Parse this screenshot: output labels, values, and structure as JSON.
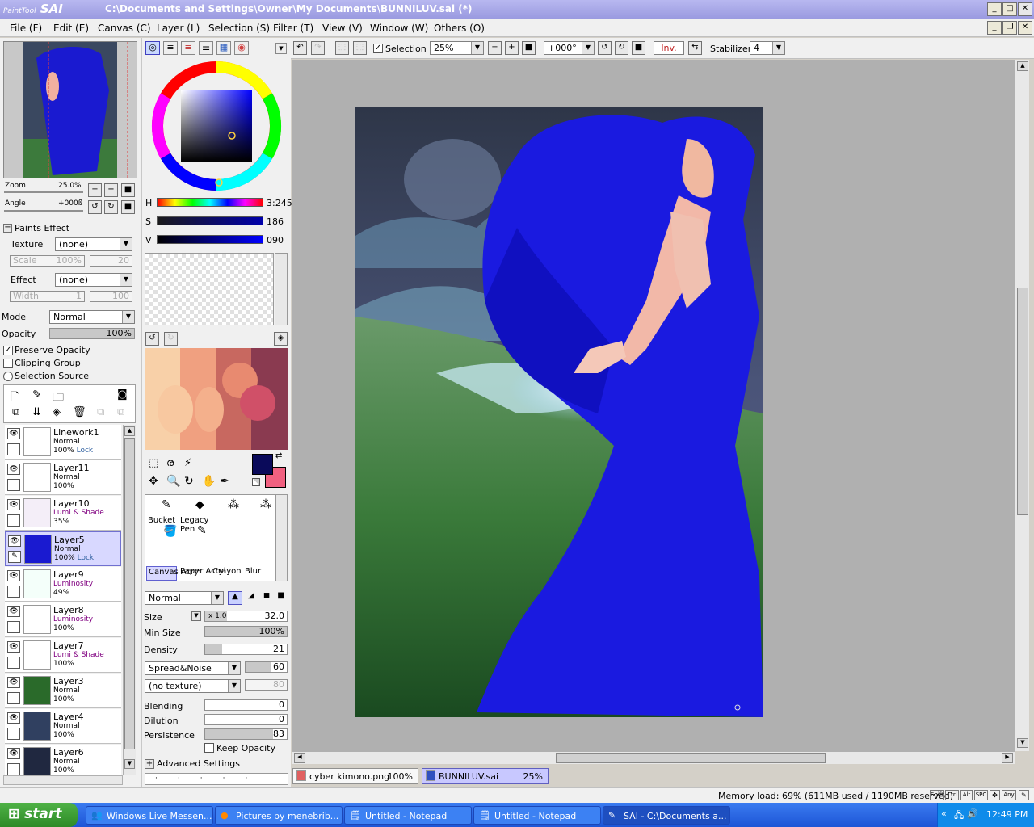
{
  "window": {
    "logo_small": "PaintTool",
    "logo_big": "SAI",
    "title": "C:\\Documents and Settings\\Owner\\My Documents\\BUNNILUV.sai (*)"
  },
  "menu": [
    "File (F)",
    "Edit (E)",
    "Canvas (C)",
    "Layer (L)",
    "Selection (S)",
    "Filter (T)",
    "View (V)",
    "Window (W)",
    "Others (O)"
  ],
  "navigator": {
    "zoom_label": "Zoom",
    "zoom_value": "25.0%",
    "angle_label": "Angle",
    "angle_value": "+000ß"
  },
  "paints_effect": {
    "title": "Paints Effect",
    "texture_label": "Texture",
    "texture_value": "(none)",
    "scale_label": "Scale",
    "scale_value": "100%",
    "scale_num": "20",
    "effect_label": "Effect",
    "effect_value": "(none)",
    "width_label": "Width",
    "width_value": "1",
    "width_num": "100"
  },
  "layer_props": {
    "mode_label": "Mode",
    "mode_value": "Normal",
    "opacity_label": "Opacity",
    "opacity_value": "100%",
    "opacity_fraction": 1.0,
    "preserve_opacity": "Preserve Opacity",
    "clipping_group": "Clipping Group",
    "selection_source": "Selection Source"
  },
  "layers": [
    {
      "name": "Linework1",
      "mode": "Normal",
      "opacity": "100%",
      "lock": "Lock",
      "purple": false,
      "active": false
    },
    {
      "name": "Layer11",
      "mode": "Normal",
      "opacity": "100%",
      "lock": "",
      "purple": false,
      "active": false
    },
    {
      "name": "Layer10",
      "mode": "Lumi & Shade",
      "opacity": "35%",
      "lock": "",
      "purple": true,
      "active": false
    },
    {
      "name": "Layer5",
      "mode": "Normal",
      "opacity": "100%",
      "lock": "Lock",
      "purple": false,
      "active": true
    },
    {
      "name": "Layer9",
      "mode": "Luminosity",
      "opacity": "49%",
      "lock": "",
      "purple": true,
      "active": false
    },
    {
      "name": "Layer8",
      "mode": "Luminosity",
      "opacity": "100%",
      "lock": "",
      "purple": true,
      "active": false
    },
    {
      "name": "Layer7",
      "mode": "Lumi & Shade",
      "opacity": "100%",
      "lock": "",
      "purple": true,
      "active": false
    },
    {
      "name": "Layer3",
      "mode": "Normal",
      "opacity": "100%",
      "lock": "",
      "purple": false,
      "active": false
    },
    {
      "name": "Layer4",
      "mode": "Normal",
      "opacity": "100%",
      "lock": "",
      "purple": false,
      "active": false
    },
    {
      "name": "Layer6",
      "mode": "Normal",
      "opacity": "100%",
      "lock": "",
      "purple": false,
      "active": false
    }
  ],
  "color": {
    "h_label": "H",
    "h_value": "3:245",
    "s_label": "S",
    "s_value": "186",
    "v_label": "V",
    "v_value": "090",
    "primary": "#0a0a5a",
    "secondary": "#f06080"
  },
  "tools": {
    "row1": [
      "Pen",
      "Eraser",
      "AirBrush",
      "Marker"
    ],
    "row2": [
      "Bucket",
      "Legacy Pen"
    ],
    "row3": [
      "Canvas Acryl",
      "Paper Acryl",
      "Crayon",
      "Blur"
    ]
  },
  "brush": {
    "mode": "Normal",
    "size_label": "Size",
    "size_mult": "x 1.0",
    "size_value": "32.0",
    "minsize_label": "Min Size",
    "minsize_value": "100%",
    "density_label": "Density",
    "density_value": "21",
    "spread_label": "Spread&Noise",
    "spread_value": "60",
    "texture_label": "(no texture)",
    "texture_value": "80",
    "blending_label": "Blending",
    "blending_value": "0",
    "dilution_label": "Dilution",
    "dilution_value": "0",
    "persistence_label": "Persistence",
    "persistence_value": "83",
    "keep_opacity": "Keep Opacity",
    "advanced": "Advanced Settings"
  },
  "toolbar": {
    "selection_label": "Selection",
    "zoom_value": "25%",
    "angle_value": "+000°",
    "inv_label": "Inv.",
    "stabilizer_label": "Stabilizer",
    "stabilizer_value": "4"
  },
  "tabs": [
    {
      "name": "cyber kimono.png",
      "pct": "100%"
    },
    {
      "name": "BUNNILUV.sai",
      "pct": "25%"
    }
  ],
  "status": {
    "memory": "Memory load: 69% (611MB used / 1190MB reserved)",
    "keys": [
      "Shift",
      "Ctrl",
      "Alt",
      "SPC",
      "Any"
    ]
  },
  "taskbar": {
    "start": "start",
    "tasks": [
      "Windows Live Messen...",
      "Pictures by menebrib...",
      "Untitled - Notepad",
      "Untitled - Notepad",
      "SAI - C:\\Documents a..."
    ],
    "clock": "12:49 PM"
  }
}
